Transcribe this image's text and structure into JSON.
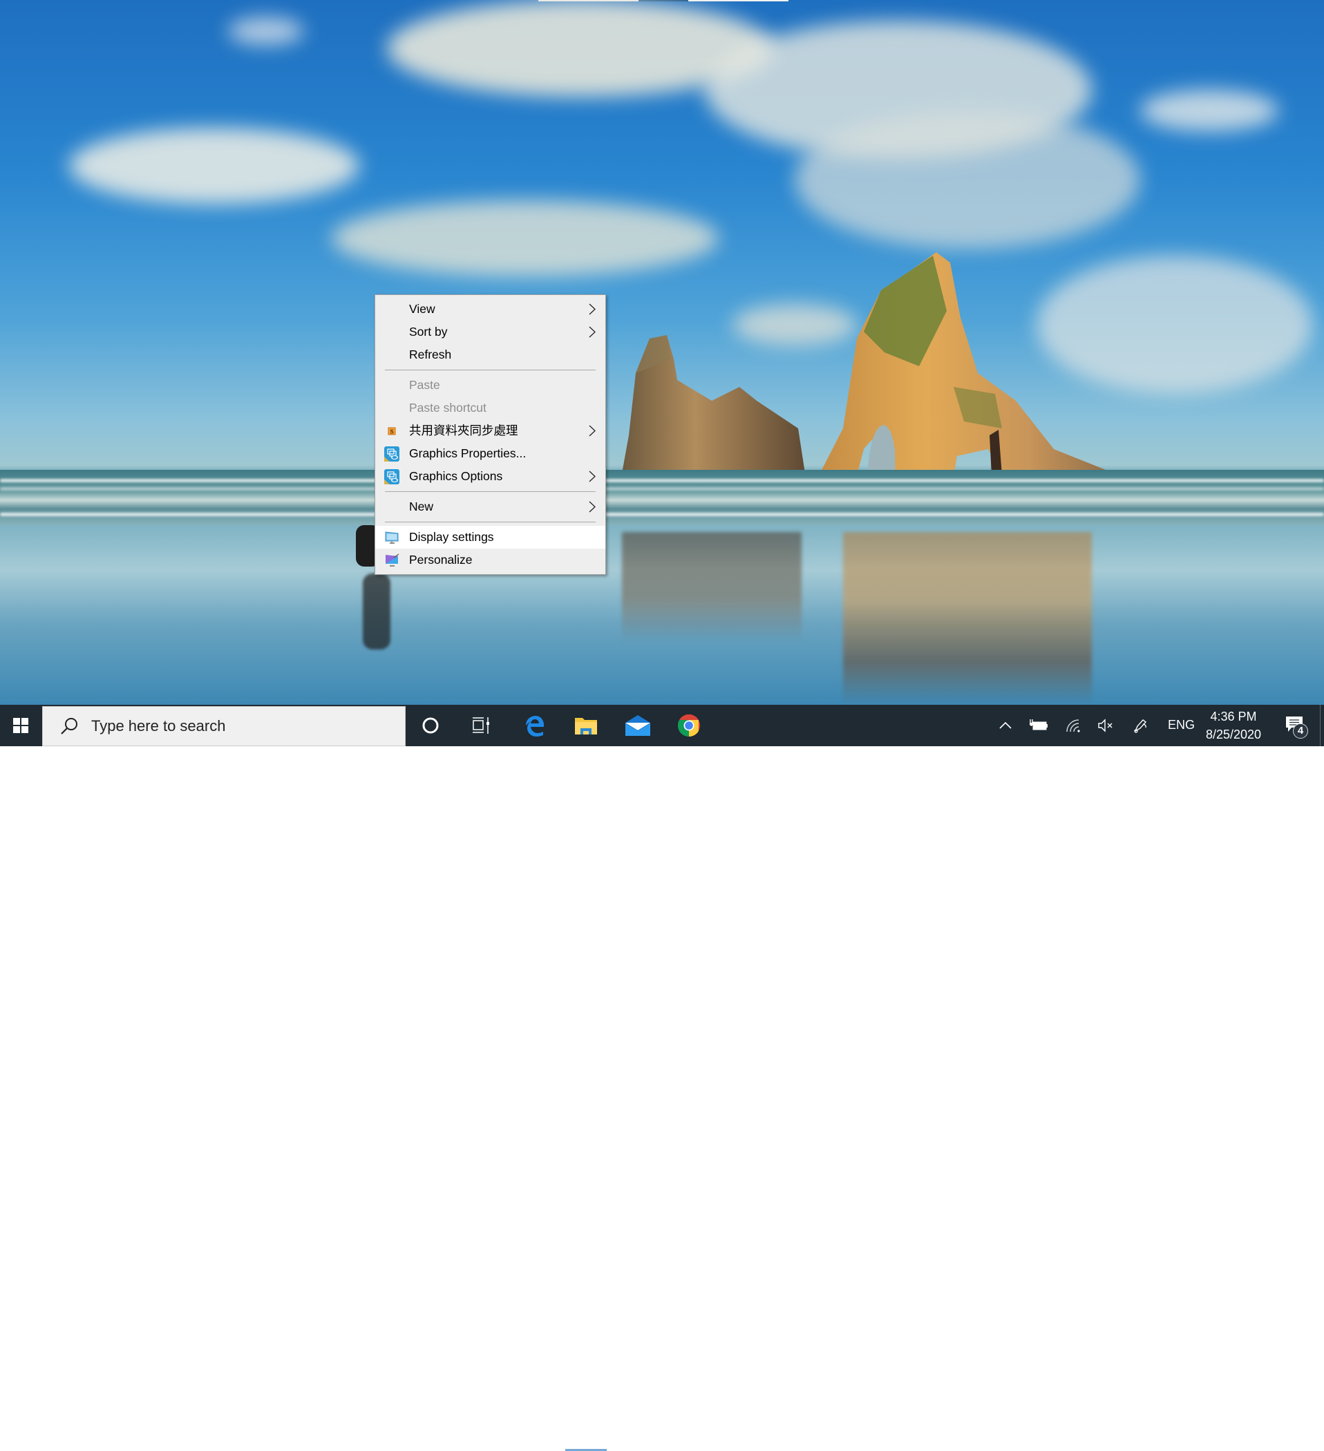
{
  "desktop": {
    "wallpaper": "Windows 10 beach with rock arches at sunset",
    "top_window_edge": {
      "colors": [
        "#e8eaed",
        "#0b4a84",
        "#f3f3f3"
      ]
    }
  },
  "context_menu": {
    "groups": [
      [
        {
          "label": "View",
          "has_submenu": true,
          "disabled": false,
          "icon": null
        },
        {
          "label": "Sort by",
          "has_submenu": true,
          "disabled": false,
          "icon": null
        },
        {
          "label": "Refresh",
          "has_submenu": false,
          "disabled": false,
          "icon": null
        }
      ],
      [
        {
          "label": "Paste",
          "has_submenu": false,
          "disabled": true,
          "icon": null
        },
        {
          "label": "Paste shortcut",
          "has_submenu": false,
          "disabled": true,
          "icon": null
        },
        {
          "label": "共用資料夾同步處理",
          "has_submenu": true,
          "disabled": false,
          "icon": "sync-s-icon"
        },
        {
          "label": "Graphics Properties...",
          "has_submenu": false,
          "disabled": false,
          "icon": "intel-graphics-icon"
        },
        {
          "label": "Graphics Options",
          "has_submenu": true,
          "disabled": false,
          "icon": "intel-graphics-icon"
        }
      ],
      [
        {
          "label": "New",
          "has_submenu": true,
          "disabled": false,
          "icon": null
        }
      ],
      [
        {
          "label": "Display settings",
          "has_submenu": false,
          "disabled": false,
          "icon": "display-icon",
          "highlighted": true
        },
        {
          "label": "Personalize",
          "has_submenu": false,
          "disabled": false,
          "icon": "personalize-icon"
        }
      ]
    ]
  },
  "taskbar": {
    "start_icon": "windows-logo-icon",
    "search": {
      "placeholder": "Type here to search",
      "icon": "search-icon"
    },
    "pinned": [
      {
        "name": "cortana",
        "icon": "cortana-circle-icon"
      },
      {
        "name": "task-view",
        "icon": "task-view-icon"
      },
      {
        "name": "edge",
        "icon": "edge-icon"
      },
      {
        "name": "file-explorer",
        "icon": "folder-icon",
        "active": true
      },
      {
        "name": "mail",
        "icon": "mail-icon"
      },
      {
        "name": "chrome",
        "icon": "chrome-icon"
      }
    ],
    "tray": {
      "chevron_icon": "chevron-up-icon",
      "battery_icon": "battery-charging-icon",
      "network_icon": "wifi-icon",
      "volume_icon": "volume-muted-icon",
      "pen_icon": "pen-workspace-icon",
      "language": "ENG",
      "time": "4:36 PM",
      "date": "8/25/2020",
      "notifications_count": "4"
    }
  }
}
